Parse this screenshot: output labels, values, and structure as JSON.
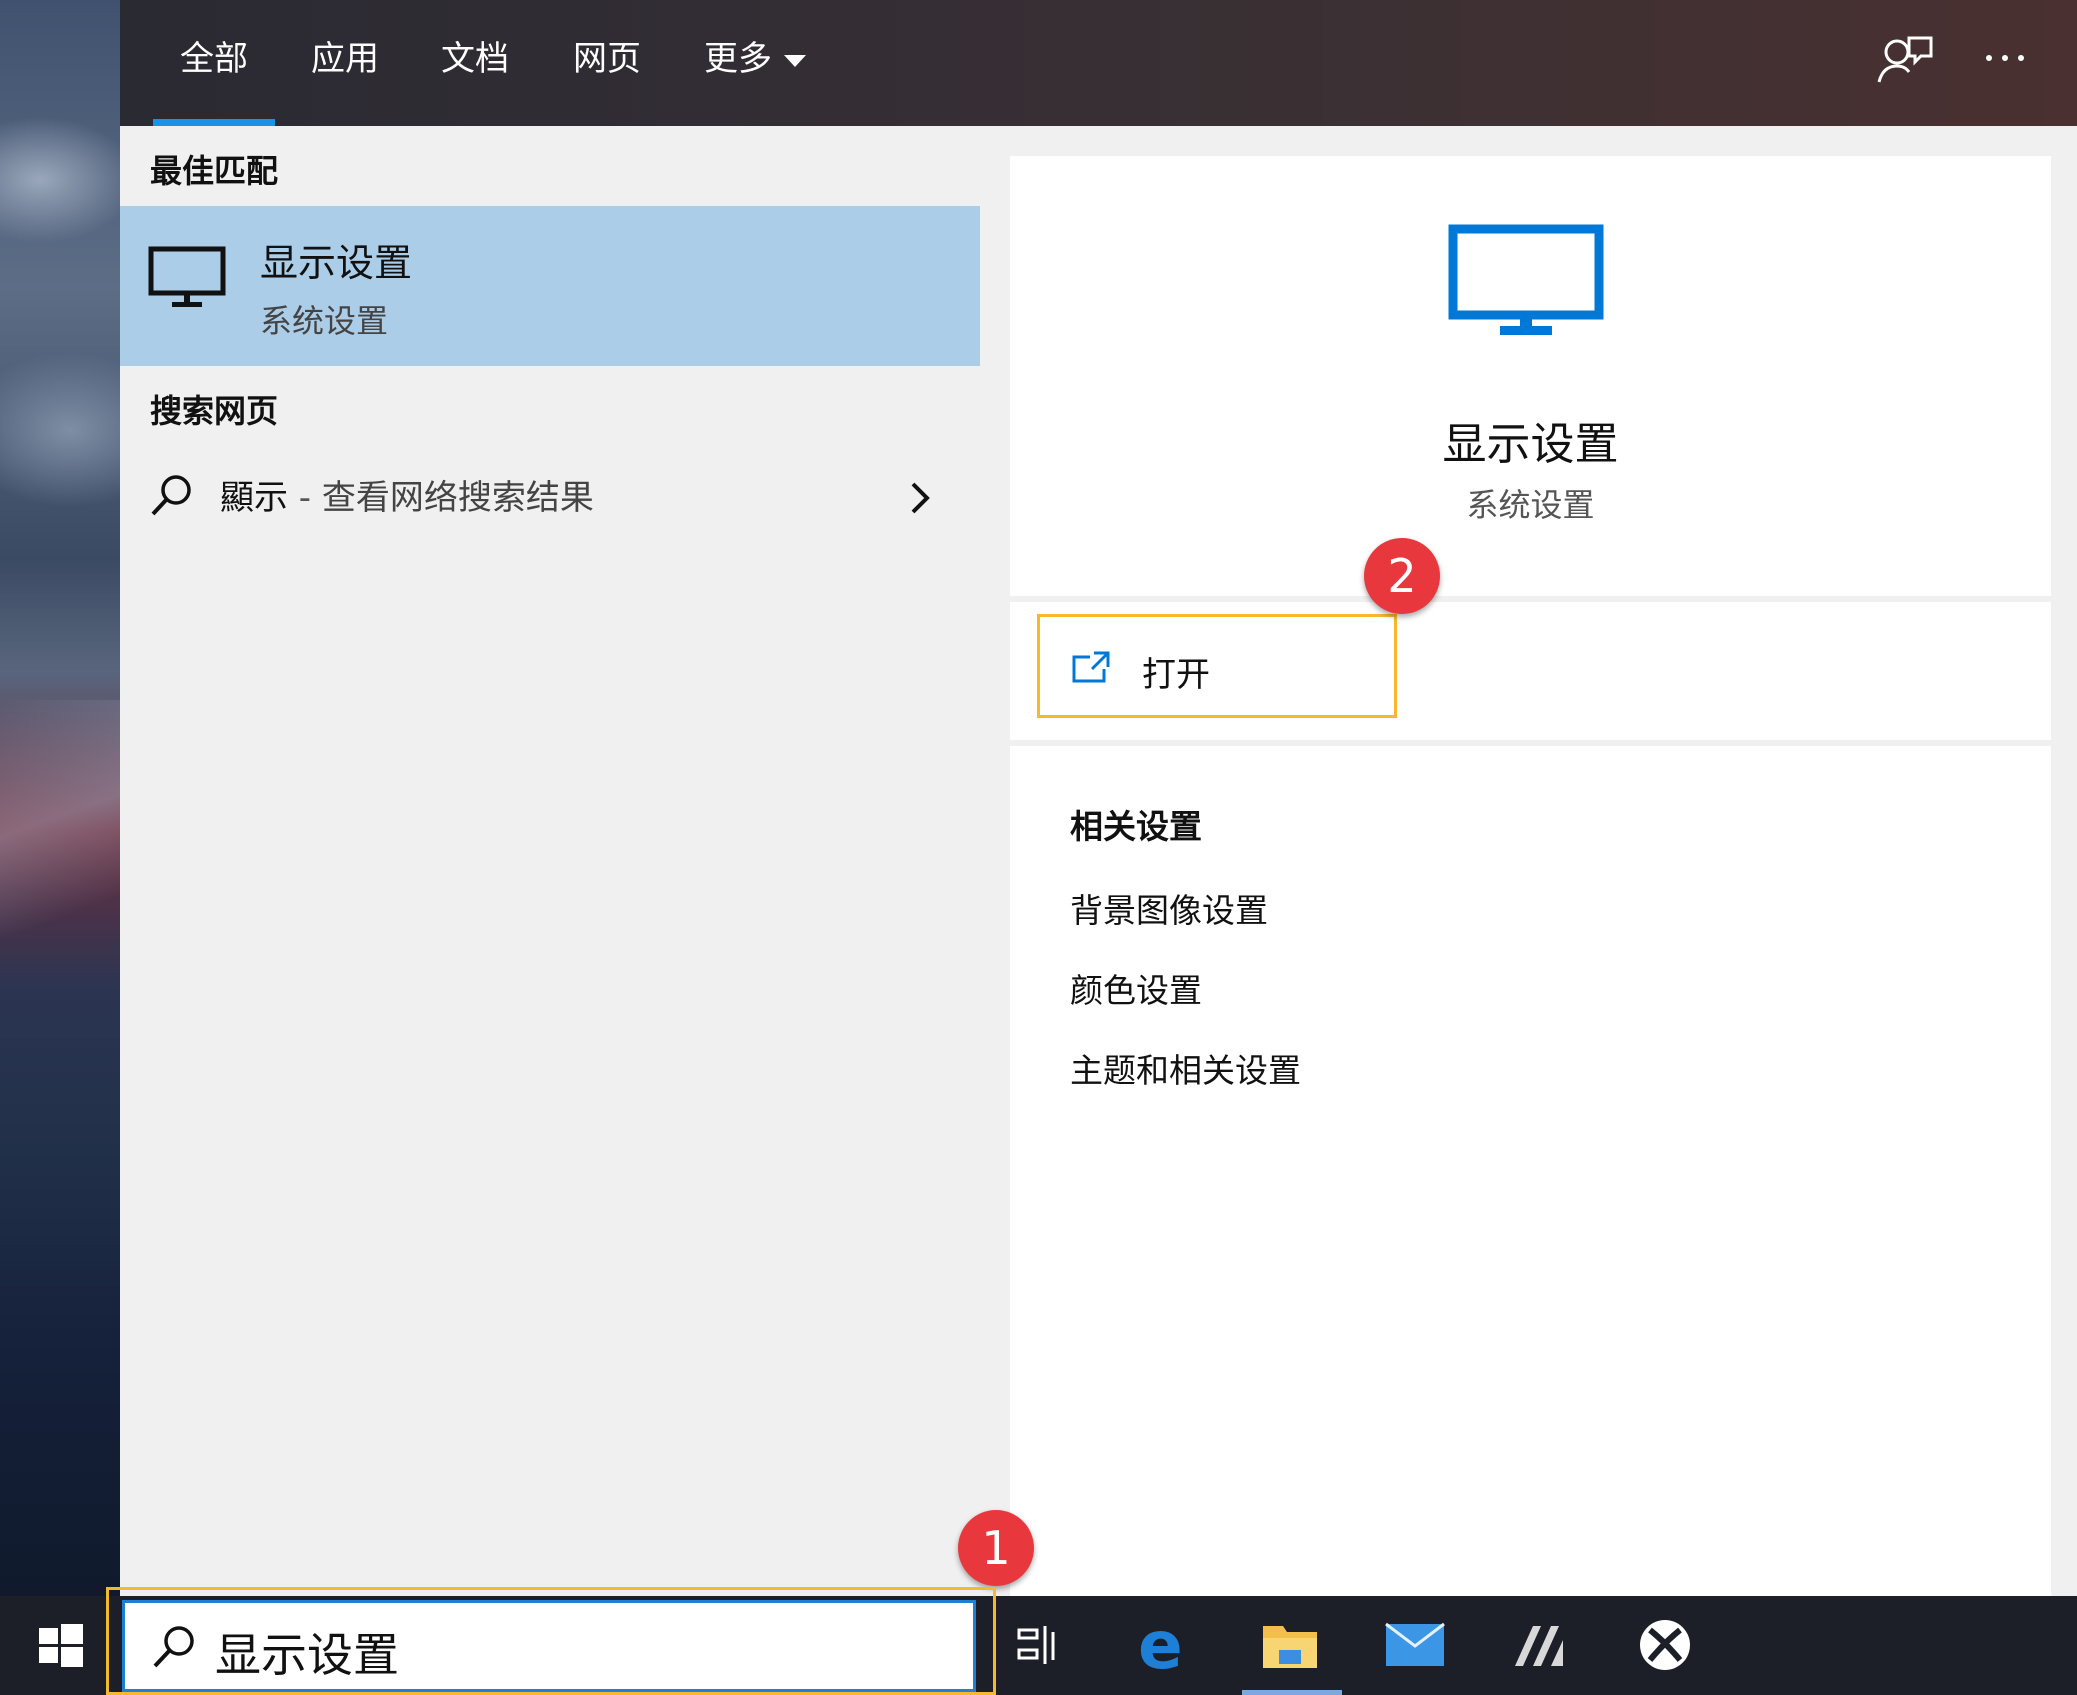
{
  "tabs": [
    {
      "label": "全部",
      "active": true
    },
    {
      "label": "应用"
    },
    {
      "label": "文档"
    },
    {
      "label": "网页"
    },
    {
      "label": "更多"
    }
  ],
  "header_icons": [
    "feedback-icon",
    "more-options-icon"
  ],
  "left_panel": {
    "best_match_heading": "最佳匹配",
    "best_match": {
      "title": "显示设置",
      "subtitle": "系统设置",
      "icon": "monitor-icon"
    },
    "web_heading": "搜索网页",
    "web_result": {
      "query": "顯示",
      "separator": " - ",
      "description": "查看网络搜索结果"
    }
  },
  "detail": {
    "title": "显示设置",
    "subtitle": "系统设置",
    "open_label": "打开",
    "related_heading": "相关设置",
    "related_links": [
      "背景图像设置",
      "颜色设置",
      "主题和相关设置"
    ]
  },
  "markers": {
    "one": "1",
    "two": "2"
  },
  "search": {
    "value": "显示设置"
  },
  "taskbar_icons": [
    "windows-start-icon",
    "task-view-icon",
    "edge-icon",
    "file-explorer-icon",
    "mail-icon",
    "app-icon",
    "xbox-icon"
  ],
  "colors": {
    "accent": "#0078d7",
    "selection": "#abcde8",
    "highlight": "#f5b82e",
    "marker": "#e8383d"
  }
}
